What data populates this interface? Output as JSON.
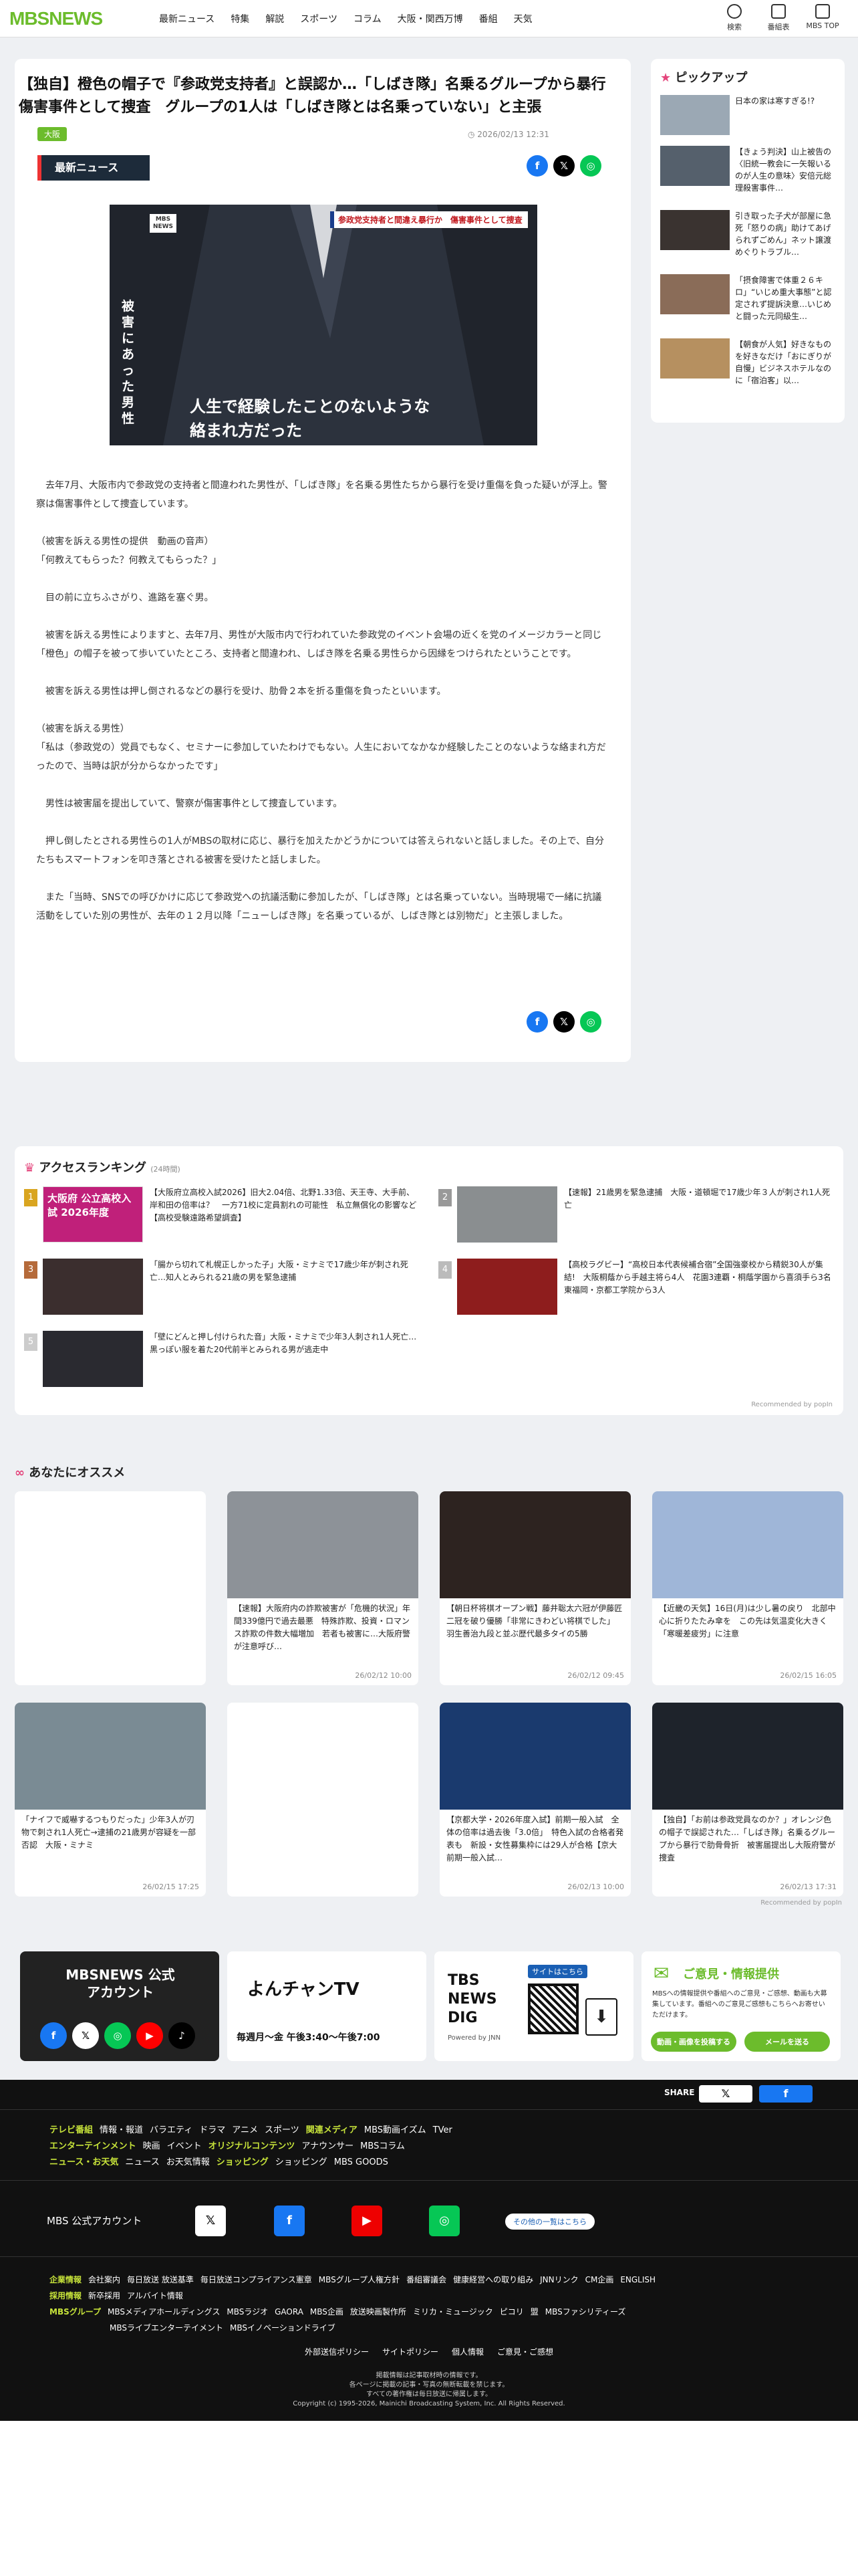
{
  "header": {
    "logo": "MBSNEWS",
    "nav": [
      "最新ニュース",
      "特集",
      "解説",
      "スポーツ",
      "コラム",
      "大阪・関西万博",
      "番組",
      "天気"
    ],
    "icons": [
      {
        "label": "検索",
        "icon": "search-icon"
      },
      {
        "label": "番組表",
        "icon": "calendar-icon"
      },
      {
        "label": "MBS TOP",
        "icon": "home-icon"
      }
    ]
  },
  "article": {
    "title": "【独自】橙色の帽子で『参政党支持者』と誤認か…「しばき隊」名乗るグループから暴行　傷害事件として捜査　グループの1人は「しばき隊とは名乗っていない」と主張",
    "tag": "大阪",
    "date": "2026/02/13 12:31",
    "badge": "最新ニュース",
    "hero": {
      "logo": "MBS NEWS",
      "headline": "参政党支持者と間違え暴行か　傷害事件として捜査",
      "side": "被害にあった男性",
      "caption1": "人生で経験したことのないような",
      "caption2": "絡まれ方だった"
    },
    "paragraphs": [
      "　去年7月、大阪市内で参政党の支持者と間違われた男性が、「しばき隊」を名乗る男性たちから暴行を受け重傷を負った疑いが浮上。警察は傷害事件として捜査しています。",
      "（被害を訴える男性の提供　動画の音声）\n「何教えてもらった？何教えてもらった？」",
      "　目の前に立ちふさがり、進路を塞ぐ男。",
      "　被害を訴える男性によりますと、去年7月、男性が大阪市内で行われていた参政党のイベント会場の近くを党のイメージカラーと同じ「橙色」の帽子を被って歩いていたところ、支持者と間違われ、しばき隊を名乗る男性らから因縁をつけられたということです。",
      "　被害を訴える男性は押し倒されるなどの暴行を受け、肋骨２本を折る重傷を負ったといいます。",
      "（被害を訴える男性）\n「私は（参政党の）党員でもなく、セミナーに参加していたわけでもない。人生においてなかなか経験したことのないような絡まれ方だったので、当時は訳が分からなかったです」",
      "　男性は被害届を提出していて、警察が傷害事件として捜査しています。",
      "　押し倒したとされる男性らの1人がMBSの取材に応じ、暴行を加えたかどうかについては答えられないと話しました。その上で、自分たちもスマートフォンを叩き落とされる被害を受けたと話しました。",
      "　また「当時、SNSでの呼びかけに応じて参政党への抗議活動に参加したが、「しばき隊」とは名乗っていない。当時現場で一緒に抗議活動をしていた別の男性が、去年の１２月以降「ニューしばき隊」を名乗っているが、しばき隊とは別物だ」と主張しました。"
    ]
  },
  "pickup": {
    "title": "ピックアップ",
    "items": [
      "日本の家は寒すぎる!?",
      "【きょう判決】山上被告の〈旧統一教会に一矢報いるのが人生の意味〉安倍元総理殺害事件…",
      "引き取った子犬が部屋に急死「怒りの病」助けてあげられずごめん」ネット譲渡めぐりトラブル…",
      "「摂食障害で体重２６キロ」“いじめ重大事態”と認定されず提訴決意…いじめと闘った元同級生…",
      "【朝食が人気】好きなものを好きなだけ「おにぎりが自慢」ビジネスホテルなのに「宿泊客」以…"
    ]
  },
  "ranking": {
    "title": "アクセスランキング",
    "period": "(24時間)",
    "credit": "Recommended by popIn",
    "items": [
      {
        "no": "1",
        "text": "【大阪府立高校入試2026】旧大2.04倍、北野1.33倍、天王寺、大手前、岸和田の倍率は？　一方71校に定員割れの可能性　私立無償化の影響など【高校受験遠路希望調査】",
        "thumb": "大阪府 公立高校入試 2026年度"
      },
      {
        "no": "2",
        "text": "【速報】21歳男を緊急逮捕　大阪・道頓堀で17歳少年３人が刺され1人死亡",
        "thumb": ""
      },
      {
        "no": "3",
        "text": "「腸から切れて札幌正しかった子」大阪・ミナミで17歳少年が刺され死亡…知人とみられる21歳の男を緊急逮捕",
        "thumb": ""
      },
      {
        "no": "4",
        "text": "【高校ラグビー】“高校日本代表候補合宿”全国強豪校から精鋭30人が集結!　大阪桐蔭から手越主将ら4人　花園3連覇・桐蔭学園から喜須手ら3名　東福岡・京都工学院から3人",
        "thumb": ""
      },
      {
        "no": "5",
        "text": "「壁にどんと押し付けられた音」大阪・ミナミで少年3人刺され1人死亡…黒っぽい服を着た20代前半とみられる男が逃走中",
        "thumb": ""
      }
    ]
  },
  "recommend": {
    "title": "あなたにオススメ",
    "credit": "Recommended by popIn",
    "cards": [
      {
        "text": "",
        "date": ""
      },
      {
        "text": "【速報】大阪府内の詐欺被害が「危機的状況」年間339億円で過去最悪　特殊詐欺、投資・ロマンス詐欺の件数大幅増加　若者も被害に…大阪府警が注意呼び…",
        "date": "26/02/12 10:00"
      },
      {
        "text": "【朝日杯将棋オープン戦】藤井聡太六冠が伊藤匠二冠を破り優勝「非常にきわどい将棋でした」　羽生善治九段と並ぶ歴代最多タイの5勝",
        "date": "26/02/12 09:45"
      },
      {
        "text": "【近畿の天気】16日(月)は少し暑の戻り　北部中心に折りたたみ傘を　この先は気温変化大きく「寒暖差疲労」に注意",
        "date": "26/02/15 16:05"
      },
      {
        "text": "「ナイフで威嚇するつもりだった」少年3人が刃物で刺され1人死亡→逮捕の21歳男が容疑を一部否認　大阪・ミナミ",
        "date": "26/02/15 17:25"
      },
      {
        "text": "",
        "date": ""
      },
      {
        "text": "【京都大学・2026年度入試】前期一般入試　全体の倍率は過去後「3.0倍」　特色入試の合格者発表も　新設・女性募集枠には29人が合格【京大前期一般入試…",
        "date": "26/02/13 10:00"
      },
      {
        "text": "【独自】「お前は参政党員なのか？」オレンジ色の帽子で誤認された…「しばき隊」名乗るグループから暴行で肋骨骨折　被害届提出し大阪府警が捜査",
        "date": "26/02/13 17:31"
      }
    ]
  },
  "promos": {
    "official": "MBSNEWS 公式アカウント",
    "yon": "よんチャンTV",
    "yon_time": "毎週月〜金 午後3:40〜午後7:00",
    "tbs": "TBS NEWS DIG",
    "tbs_sub": "Powered by JNN",
    "tbs_qr": "サイトはこちら",
    "opinion": "ご意見・情報提供",
    "opinion_desc": "MBSへの情報提供や番組へのご意見・ご感想、動画も大募集しています。番組へのご意見ご感想もこちらへお寄せいただけます。",
    "opinion_b1": "動画・画像を投稿する",
    "opinion_b2": "メールを送る"
  },
  "footer": {
    "share": "SHARE",
    "row1": {
      "g1": "テレビ番組",
      "i1": [
        "情報・報道",
        "バラエティ",
        "ドラマ",
        "アニメ",
        "スポーツ"
      ],
      "g2": "関連メディア",
      "i2": [
        "MBS動画イズム",
        "TVer"
      ]
    },
    "row2": {
      "g1": "エンターテインメント",
      "i1": [
        "映画",
        "イベント"
      ],
      "g2": "オリジナルコンテンツ",
      "i2": [
        "アナウンサー",
        "MBSコラム"
      ]
    },
    "row3": {
      "g1": "ニュース・お天気",
      "i1": [
        "ニュース",
        "お天気情報"
      ],
      "g2": "ショッピング",
      "i2": [
        "ショッピング",
        "MBS GOODS"
      ]
    },
    "official": "MBS 公式アカウント",
    "others": "その他の一覧はこちら",
    "corp": {
      "g1": "企業情報",
      "i1": [
        "会社案内",
        "毎日放送 放送基準",
        "毎日放送コンプライアンス憲章",
        "MBSグループ人権方針",
        "番組審議会",
        "健康経営への取り組み",
        "JNNリンク",
        "CM企画",
        "ENGLISH"
      ],
      "g2": "採用情報",
      "i2": [
        "新卒採用",
        "アルバイト情報"
      ],
      "g3": "MBSグループ",
      "i3": [
        "MBSメディアホールディングス",
        "MBSラジオ",
        "GAORA",
        "MBS企画",
        "放送映画製作所",
        "ミリカ・ミュージック",
        "ピコリ",
        "盟",
        "MBSファシリティーズ"
      ],
      "i4": [
        "MBSライブエンターテイメント",
        "MBSイノベーションドライブ"
      ]
    },
    "policy": [
      "外部送信ポリシー",
      "サイトポリシー",
      "個人情報",
      "ご意見・ご感想"
    ],
    "copy1": "掲載情報は記事取材時の情報です。",
    "copy2": "各ページに掲載の記事・写真の無断転載を禁じます。",
    "copy3": "すべての著作権は毎日放送に帰属します。",
    "copy4": "Copyright (c) 1995-2026, Mainichi Broadcasting System, Inc. All Rights Reserved."
  }
}
